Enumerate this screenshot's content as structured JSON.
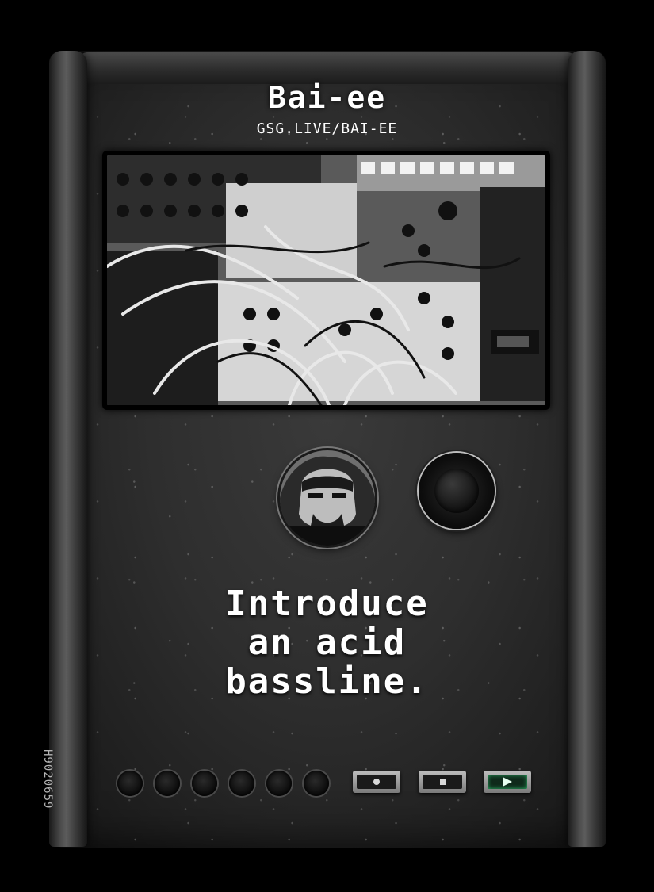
{
  "card": {
    "title": "Bai-ee",
    "url": "GSG.LIVE/BAI-EE",
    "prompt_lines": [
      "Introduce",
      "an acid",
      "bassline."
    ],
    "serial": "H9020659"
  },
  "colors": {
    "background": "#000000",
    "panel": "#2e2e2e",
    "text": "#ffffff",
    "play_accent": "#2fbf6e"
  },
  "controls": {
    "indicator_dots": 6,
    "buttons": [
      "record-icon",
      "stop-icon",
      "play-icon"
    ]
  }
}
